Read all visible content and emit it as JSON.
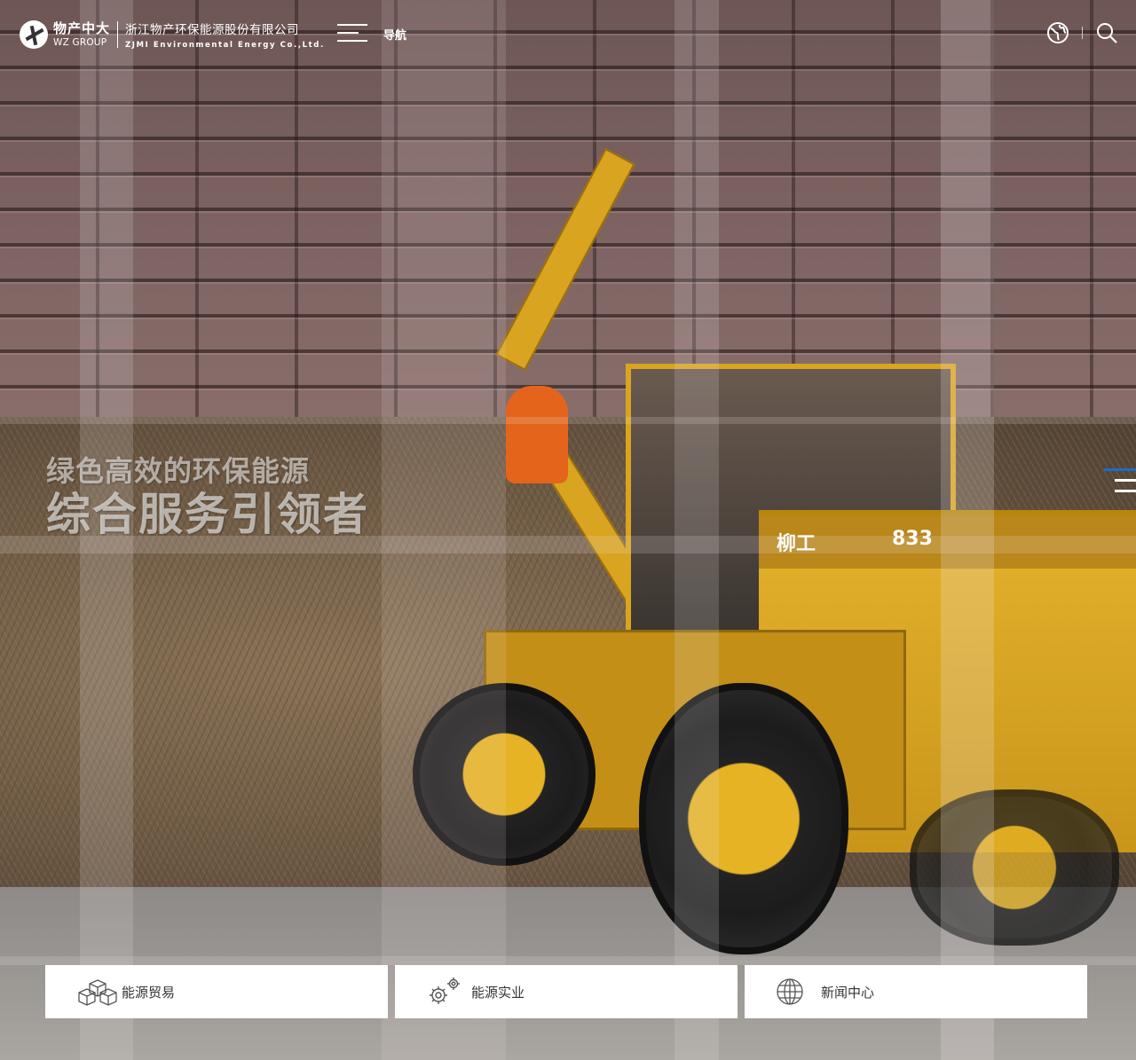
{
  "header": {
    "logo_cn": "物产中大",
    "logo_en": "WZ GROUP",
    "company_cn": "浙江物产环保能源股份有限公司",
    "company_en": "ZJMI Environmental Energy Co.,Ltd.",
    "nav_label": "导航",
    "icons": [
      "menu-icon",
      "globe-icon",
      "search-icon"
    ]
  },
  "hero": {
    "slogan_line1": "绿色高效的环保能源",
    "slogan_line2": "综合服务引领者",
    "loader_decal_brand": "柳工",
    "loader_decal_model": "833",
    "pager": {
      "count": 3,
      "active_index": 0,
      "active_color": "#1a6ec7"
    }
  },
  "quick_links": [
    {
      "label": "能源贸易",
      "icon": "cubes-icon"
    },
    {
      "label": "能源实业",
      "icon": "gears-icon"
    },
    {
      "label": "新闻中心",
      "icon": "globe-icon"
    }
  ]
}
